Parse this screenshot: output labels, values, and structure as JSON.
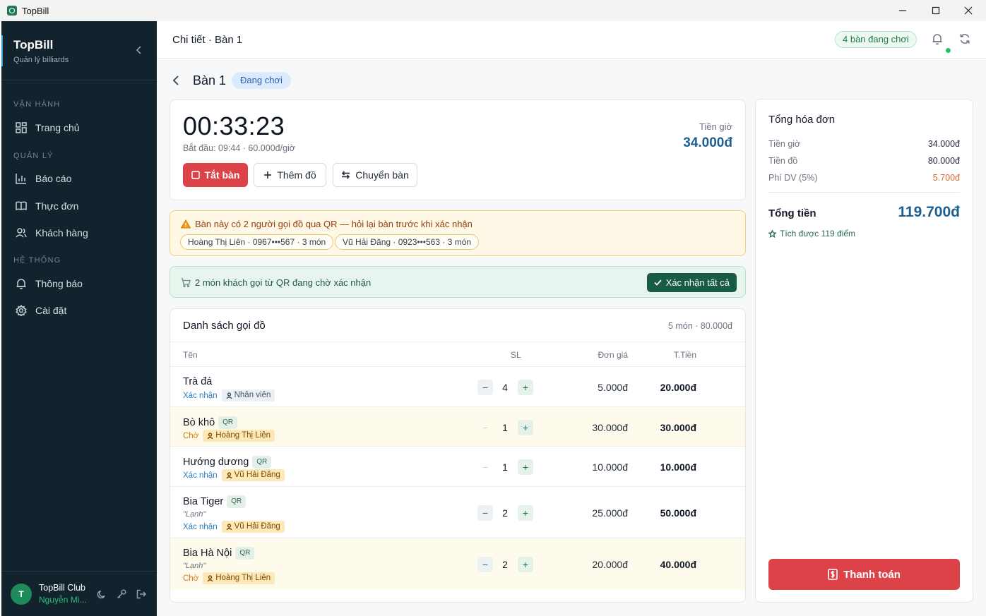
{
  "window": {
    "title": "TopBill"
  },
  "sidebar": {
    "brand": "TopBill",
    "tagline": "Quản lý billiards",
    "sections": [
      {
        "label": "VẬN HÀNH"
      },
      {
        "label": "QUẢN LÝ"
      },
      {
        "label": "HỆ THỐNG"
      }
    ],
    "items": [
      {
        "label": "Trang chủ",
        "icon": "grid-icon"
      },
      {
        "label": "Báo cáo",
        "icon": "bar-chart-icon"
      },
      {
        "label": "Thực đơn",
        "icon": "book-icon"
      },
      {
        "label": "Khách hàng",
        "icon": "users-icon"
      },
      {
        "label": "Thông báo",
        "icon": "bell-icon"
      },
      {
        "label": "Cài đặt",
        "icon": "gear-icon"
      }
    ],
    "user": {
      "avatar_letter": "T",
      "club": "TopBill Club",
      "name": "Nguyễn Mi..."
    }
  },
  "header": {
    "breadcrumb": "Chi tiết · Bàn 1",
    "active_tables": "4 bàn đang chơi"
  },
  "table": {
    "name": "Bàn 1",
    "status": "Đang chơi",
    "timer": "00:33:23",
    "start_info": "Bắt đầu: 09:44 · 60.000đ/giờ",
    "fee_label": "Tiền giờ",
    "fee_value": "34.000đ",
    "actions": {
      "close": "Tắt bàn",
      "add": "Thêm đồ",
      "move": "Chuyển bàn"
    }
  },
  "warning": {
    "text": "Bàn này có 2 người gọi đồ qua QR — hỏi lại bàn trước khi xác nhận",
    "guests": [
      "Hoàng Thị Liên · 0967•••567 · 3 món",
      "Vũ Hải Đăng · 0923•••563 · 3 món"
    ]
  },
  "qr_pending": {
    "text": "2 món khách gọi từ QR đang chờ xác nhận",
    "confirm_all": "Xác nhận tất cả"
  },
  "orders": {
    "title": "Danh sách gọi đồ",
    "summary": "5 món · 80.000đ",
    "columns": {
      "name": "Tên",
      "qty": "SL",
      "price": "Đơn giá",
      "total": "T.Tiền"
    },
    "qr_label": "QR",
    "rows": [
      {
        "name": "Trà đá",
        "note": "",
        "status": "Xác nhận",
        "who": "Nhân viên",
        "qty": "4",
        "price": "5.000đ",
        "total": "20.000đ"
      },
      {
        "name": "Bò khô",
        "note": "",
        "status": "Chờ",
        "who": "Hoàng Thị Liên",
        "qty": "1",
        "price": "30.000đ",
        "total": "30.000đ"
      },
      {
        "name": "Hướng dương",
        "note": "",
        "status": "Xác nhận",
        "who": "Vũ Hải Đăng",
        "qty": "1",
        "price": "10.000đ",
        "total": "10.000đ"
      },
      {
        "name": "Bia Tiger",
        "note": "\"Lạnh\"",
        "status": "Xác nhận",
        "who": "Vũ Hải Đăng",
        "qty": "2",
        "price": "25.000đ",
        "total": "50.000đ"
      },
      {
        "name": "Bia Hà Nội",
        "note": "\"Lạnh\"",
        "status": "Chờ",
        "who": "Hoàng Thị Liên",
        "qty": "2",
        "price": "20.000đ",
        "total": "40.000đ"
      }
    ]
  },
  "bill": {
    "title": "Tổng hóa đơn",
    "lines": [
      {
        "label": "Tiền giờ",
        "value": "34.000đ"
      },
      {
        "label": "Tiền đồ",
        "value": "80.000đ"
      },
      {
        "label": "Phí DV (5%)",
        "value": "5.700đ"
      }
    ],
    "total_label": "Tổng tiền",
    "total_value": "119.700đ",
    "points": "Tích được 119 điểm",
    "pay": "Thanh toán"
  },
  "colors": {
    "sidebar": "#12232e",
    "accent_red": "#dc4349",
    "accent_blue": "#1d5f92",
    "confirm_green": "#175c43"
  }
}
